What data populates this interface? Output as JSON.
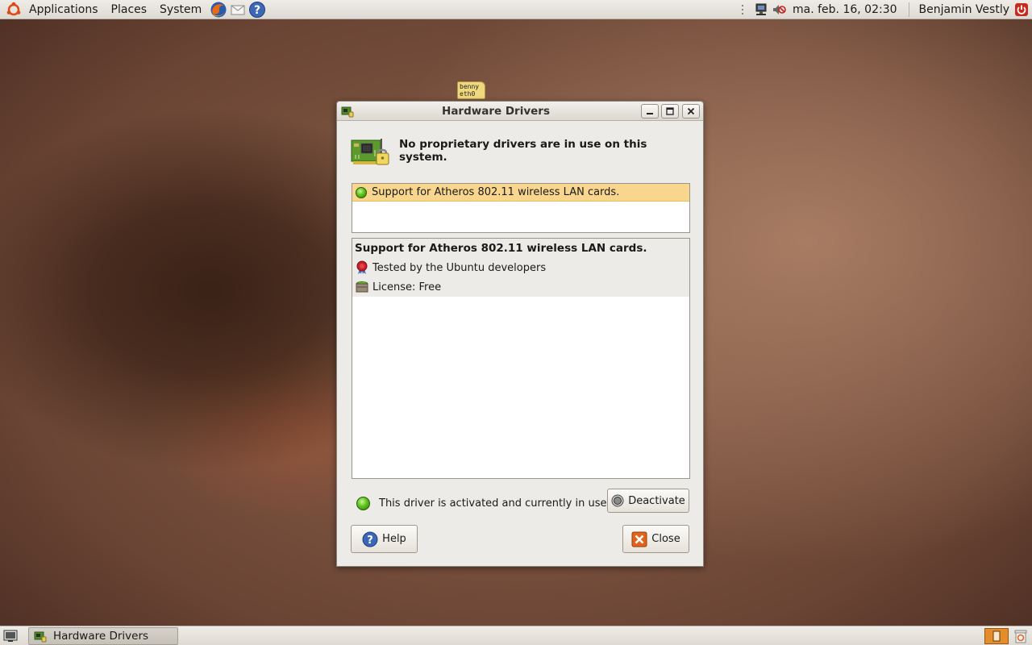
{
  "top_panel": {
    "menus": [
      "Applications",
      "Places",
      "System"
    ],
    "clock": "ma. feb. 16, 02:30",
    "user": "Benjamin Vestly"
  },
  "desktop_badge": {
    "line1": "benny",
    "line2": "eth0"
  },
  "window": {
    "title": "Hardware Drivers",
    "header": "No proprietary drivers are in use on this system.",
    "drivers": [
      {
        "label": "Support for Atheros 802.11 wireless LAN cards.",
        "status": "active"
      }
    ],
    "details": {
      "title": "Support for Atheros 802.11 wireless LAN cards.",
      "tested": "Tested by the Ubuntu developers",
      "license": "License: Free"
    },
    "status_text": "This driver is activated and currently in use.",
    "deactivate_label": "Deactivate",
    "help_label": "Help",
    "close_label": "Close"
  },
  "bottom_panel": {
    "tasks": [
      "Hardware Drivers"
    ]
  },
  "colors": {
    "selection": "#f8d68e",
    "led_green": "#5dc31b",
    "close_icon": "#e0641e",
    "help_icon": "#3b67b4",
    "workspace": "#e58d2b"
  }
}
